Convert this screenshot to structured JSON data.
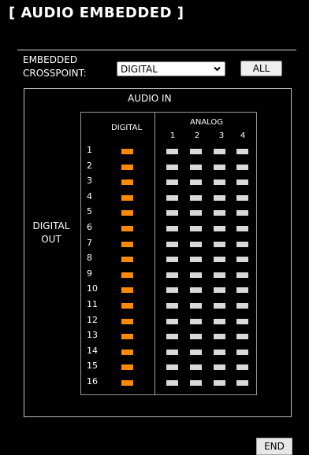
{
  "page": {
    "title": "[ AUDIO EMBEDDED ]"
  },
  "crosspoint": {
    "label_line1": "EMBEDDED",
    "label_line2": "CROSSPOINT:",
    "select_value": "DIGITAL",
    "all_button": "ALL"
  },
  "matrix": {
    "in_label": "AUDIO IN",
    "out_label_line1": "DIGITAL",
    "out_label_line2": "OUT",
    "digital_header": "DIGITAL",
    "analog_header": "ANALOG",
    "analog_channels": [
      "1",
      "2",
      "3",
      "4"
    ],
    "rows": [
      "1",
      "2",
      "3",
      "4",
      "5",
      "6",
      "7",
      "8",
      "9",
      "10",
      "11",
      "12",
      "13",
      "14",
      "15",
      "16"
    ],
    "columns": [
      "DIGITAL",
      "ANALOG 1",
      "ANALOG 2",
      "ANALOG 3",
      "ANALOG 4"
    ],
    "routing": [
      [
        1,
        0,
        0,
        0,
        0
      ],
      [
        1,
        0,
        0,
        0,
        0
      ],
      [
        1,
        0,
        0,
        0,
        0
      ],
      [
        1,
        0,
        0,
        0,
        0
      ],
      [
        1,
        0,
        0,
        0,
        0
      ],
      [
        1,
        0,
        0,
        0,
        0
      ],
      [
        1,
        0,
        0,
        0,
        0
      ],
      [
        1,
        0,
        0,
        0,
        0
      ],
      [
        1,
        0,
        0,
        0,
        0
      ],
      [
        1,
        0,
        0,
        0,
        0
      ],
      [
        1,
        0,
        0,
        0,
        0
      ],
      [
        1,
        0,
        0,
        0,
        0
      ],
      [
        1,
        0,
        0,
        0,
        0
      ],
      [
        1,
        0,
        0,
        0,
        0
      ],
      [
        1,
        0,
        0,
        0,
        0
      ],
      [
        1,
        0,
        0,
        0,
        0
      ]
    ],
    "colors": {
      "on": "#ff8a00",
      "off": "#d9d9d9"
    }
  },
  "footer": {
    "end_button": "END"
  },
  "icons": {
    "select_arrow": "chevron-down-icon"
  }
}
